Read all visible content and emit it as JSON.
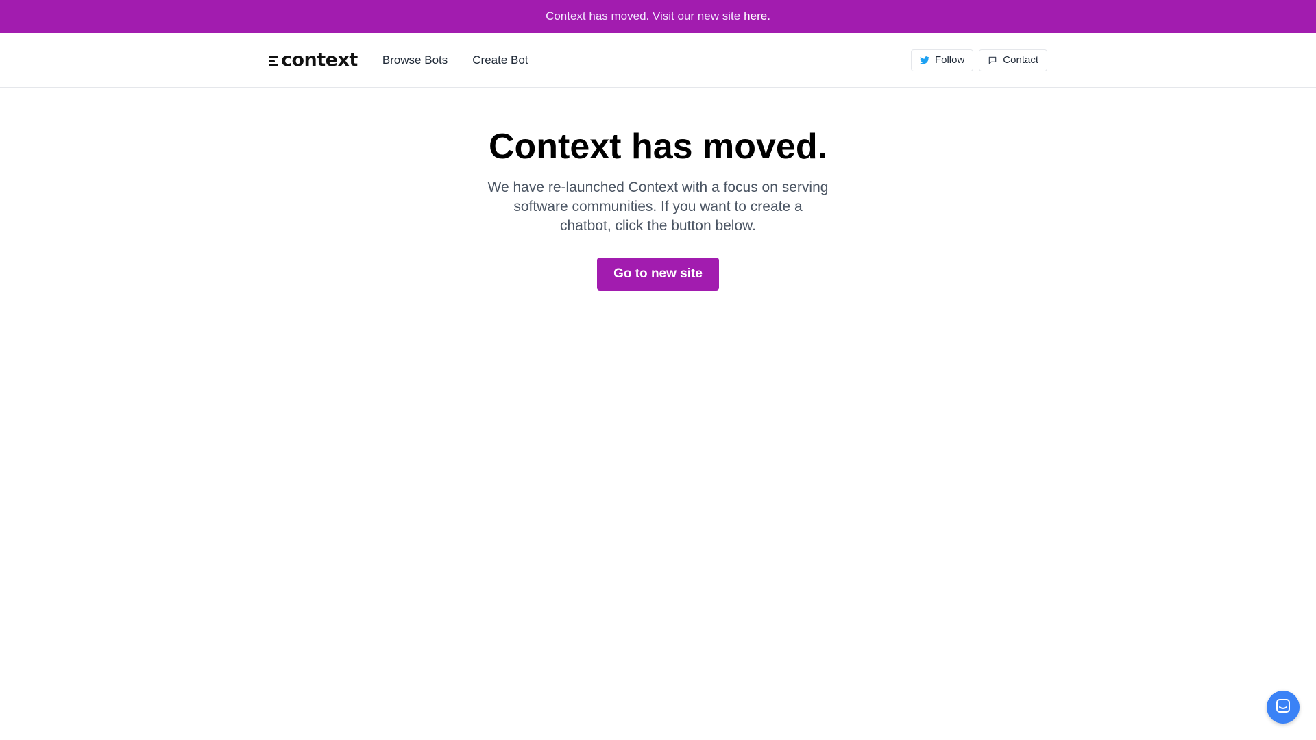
{
  "banner": {
    "text": "Context has moved. Visit our new site",
    "link_label": "here."
  },
  "header": {
    "logo_text": "context",
    "nav": {
      "browse_bots": "Browse Bots",
      "create_bot": "Create Bot"
    },
    "follow_label": "Follow",
    "contact_label": "Contact"
  },
  "hero": {
    "title": "Context has moved.",
    "description": "We have re-launched Context with a focus on serving software communities. If you want to create a chatbot, click the button below.",
    "cta_label": "Go to new site"
  },
  "colors": {
    "brand": "#a21caf",
    "chat_launcher": "#3b82f6",
    "twitter": "#1da1f2"
  },
  "icons": {
    "follow": "twitter-bird-icon",
    "contact": "chat-bubble-icon",
    "launcher": "chat-icon"
  }
}
